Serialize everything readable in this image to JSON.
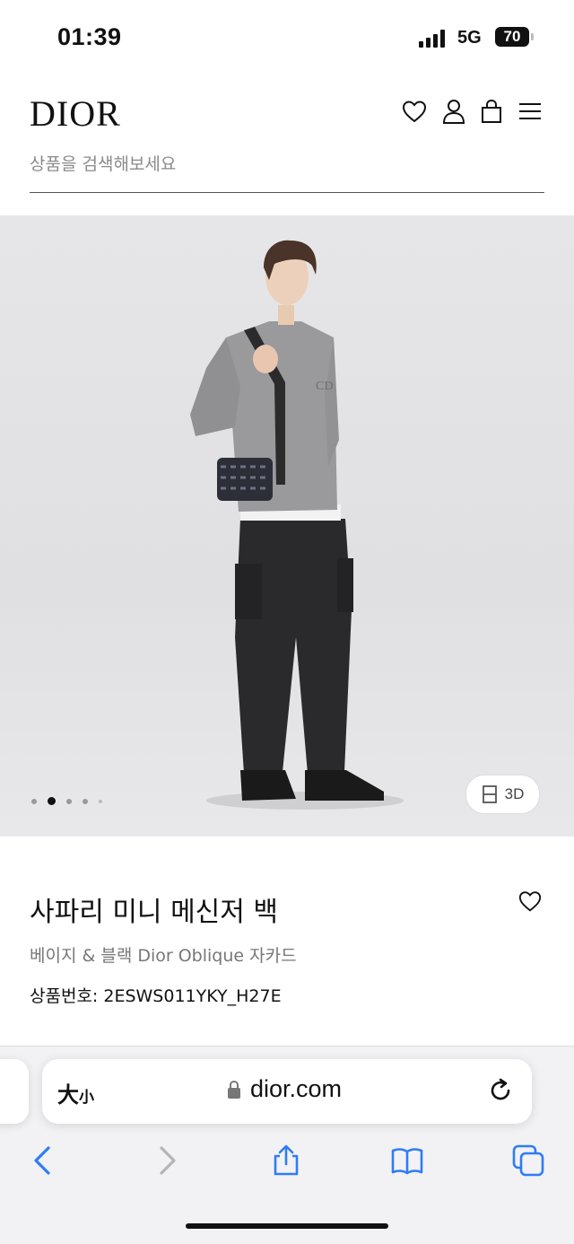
{
  "status": {
    "time": "01:39",
    "network": "5G",
    "battery": "70"
  },
  "brand": {
    "logo": "DIOR"
  },
  "header_icons": [
    "heart-icon",
    "user-icon",
    "bag-icon",
    "menu-icon"
  ],
  "search": {
    "placeholder": "상품을 검색해보세요"
  },
  "gallery": {
    "current_index": 2,
    "total": 5,
    "view3d_label": "3D"
  },
  "product": {
    "title": "사파리 미니 메신저 백",
    "subtitle": "베이지 & 블랙 Dior Oblique 자카드",
    "reference": "상품번호: 2ESWS011YKY_H27E"
  },
  "browser": {
    "text_size_big": "大",
    "text_size_small": "小",
    "domain": "dior.com",
    "toolbar": [
      "back-icon",
      "forward-icon",
      "share-icon",
      "bookmarks-icon",
      "tabs-icon"
    ]
  },
  "colors": {
    "accent": "#2f7cf6",
    "hero_bg": "#e4e4e6",
    "text": "#111111",
    "muted": "#777777"
  }
}
